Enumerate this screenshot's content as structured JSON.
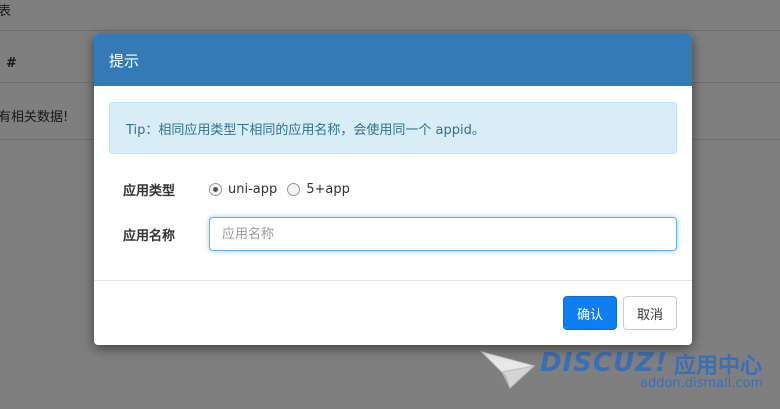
{
  "background": {
    "title": "表",
    "column_hash": "#",
    "empty_text": "有相关数据!"
  },
  "modal": {
    "title": "提示",
    "tip": "Tip：相同应用类型下相同的应用名称，会使用同一个 appid。",
    "app_type_label": "应用类型",
    "app_type_options": [
      {
        "label": "uni-app",
        "checked": true
      },
      {
        "label": "5+app",
        "checked": false
      }
    ],
    "app_name_label": "应用名称",
    "app_name_value": "",
    "app_name_placeholder": "应用名称",
    "confirm_label": "确认",
    "cancel_label": "取消"
  },
  "watermark": {
    "brand": "DISCUZ!",
    "brand_cn": "应用中心",
    "url": "addon.dismall.com"
  },
  "colors": {
    "header_bg": "#337ab7",
    "primary_button": "#0d7ff2",
    "tip_bg": "#d9edf7",
    "tip_text": "#31708f",
    "watermark": "#3b6fb5"
  }
}
